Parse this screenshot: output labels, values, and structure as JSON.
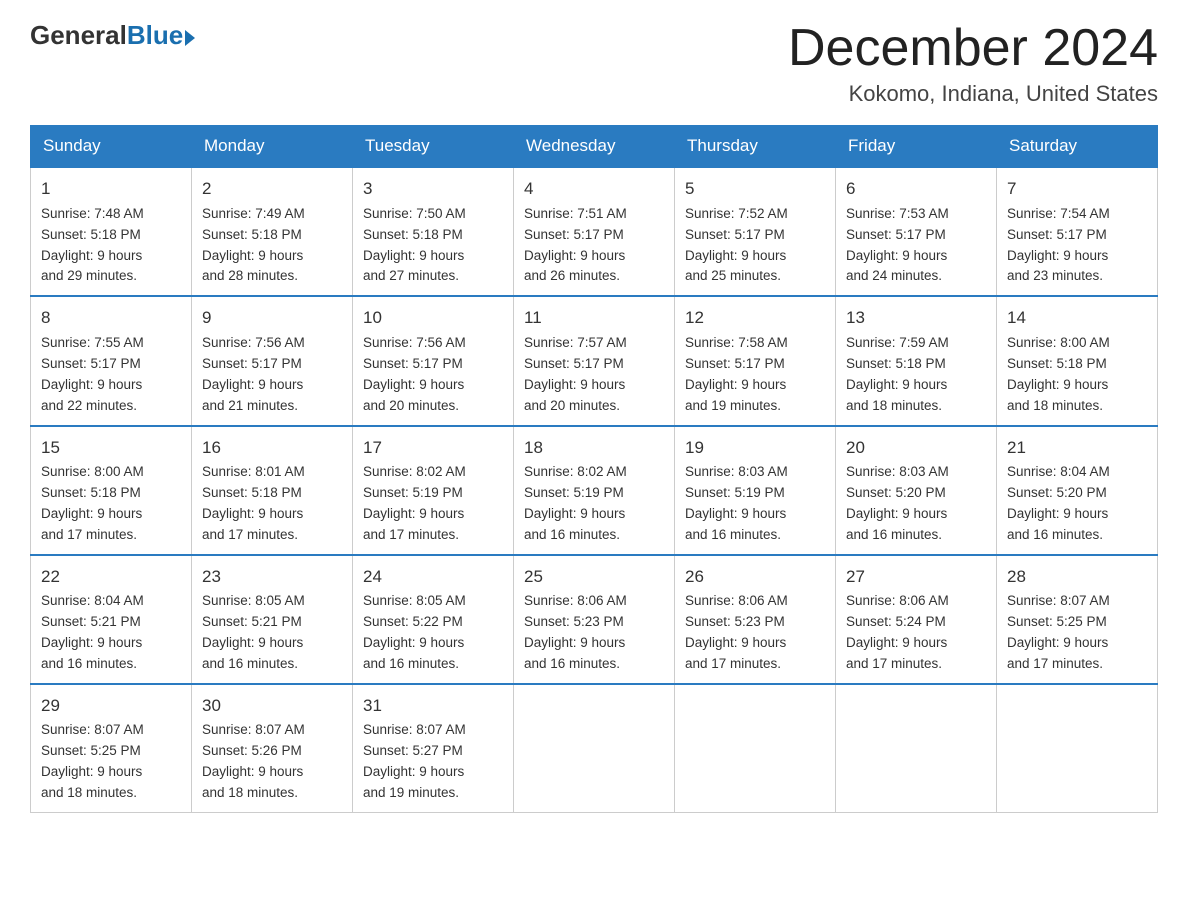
{
  "header": {
    "logo_general": "General",
    "logo_blue": "Blue",
    "month_title": "December 2024",
    "location": "Kokomo, Indiana, United States"
  },
  "weekdays": [
    "Sunday",
    "Monday",
    "Tuesday",
    "Wednesday",
    "Thursday",
    "Friday",
    "Saturday"
  ],
  "weeks": [
    [
      {
        "day": "1",
        "sunrise": "7:48 AM",
        "sunset": "5:18 PM",
        "daylight": "9 hours and 29 minutes."
      },
      {
        "day": "2",
        "sunrise": "7:49 AM",
        "sunset": "5:18 PM",
        "daylight": "9 hours and 28 minutes."
      },
      {
        "day": "3",
        "sunrise": "7:50 AM",
        "sunset": "5:18 PM",
        "daylight": "9 hours and 27 minutes."
      },
      {
        "day": "4",
        "sunrise": "7:51 AM",
        "sunset": "5:17 PM",
        "daylight": "9 hours and 26 minutes."
      },
      {
        "day": "5",
        "sunrise": "7:52 AM",
        "sunset": "5:17 PM",
        "daylight": "9 hours and 25 minutes."
      },
      {
        "day": "6",
        "sunrise": "7:53 AM",
        "sunset": "5:17 PM",
        "daylight": "9 hours and 24 minutes."
      },
      {
        "day": "7",
        "sunrise": "7:54 AM",
        "sunset": "5:17 PM",
        "daylight": "9 hours and 23 minutes."
      }
    ],
    [
      {
        "day": "8",
        "sunrise": "7:55 AM",
        "sunset": "5:17 PM",
        "daylight": "9 hours and 22 minutes."
      },
      {
        "day": "9",
        "sunrise": "7:56 AM",
        "sunset": "5:17 PM",
        "daylight": "9 hours and 21 minutes."
      },
      {
        "day": "10",
        "sunrise": "7:56 AM",
        "sunset": "5:17 PM",
        "daylight": "9 hours and 20 minutes."
      },
      {
        "day": "11",
        "sunrise": "7:57 AM",
        "sunset": "5:17 PM",
        "daylight": "9 hours and 20 minutes."
      },
      {
        "day": "12",
        "sunrise": "7:58 AM",
        "sunset": "5:17 PM",
        "daylight": "9 hours and 19 minutes."
      },
      {
        "day": "13",
        "sunrise": "7:59 AM",
        "sunset": "5:18 PM",
        "daylight": "9 hours and 18 minutes."
      },
      {
        "day": "14",
        "sunrise": "8:00 AM",
        "sunset": "5:18 PM",
        "daylight": "9 hours and 18 minutes."
      }
    ],
    [
      {
        "day": "15",
        "sunrise": "8:00 AM",
        "sunset": "5:18 PM",
        "daylight": "9 hours and 17 minutes."
      },
      {
        "day": "16",
        "sunrise": "8:01 AM",
        "sunset": "5:18 PM",
        "daylight": "9 hours and 17 minutes."
      },
      {
        "day": "17",
        "sunrise": "8:02 AM",
        "sunset": "5:19 PM",
        "daylight": "9 hours and 17 minutes."
      },
      {
        "day": "18",
        "sunrise": "8:02 AM",
        "sunset": "5:19 PM",
        "daylight": "9 hours and 16 minutes."
      },
      {
        "day": "19",
        "sunrise": "8:03 AM",
        "sunset": "5:19 PM",
        "daylight": "9 hours and 16 minutes."
      },
      {
        "day": "20",
        "sunrise": "8:03 AM",
        "sunset": "5:20 PM",
        "daylight": "9 hours and 16 minutes."
      },
      {
        "day": "21",
        "sunrise": "8:04 AM",
        "sunset": "5:20 PM",
        "daylight": "9 hours and 16 minutes."
      }
    ],
    [
      {
        "day": "22",
        "sunrise": "8:04 AM",
        "sunset": "5:21 PM",
        "daylight": "9 hours and 16 minutes."
      },
      {
        "day": "23",
        "sunrise": "8:05 AM",
        "sunset": "5:21 PM",
        "daylight": "9 hours and 16 minutes."
      },
      {
        "day": "24",
        "sunrise": "8:05 AM",
        "sunset": "5:22 PM",
        "daylight": "9 hours and 16 minutes."
      },
      {
        "day": "25",
        "sunrise": "8:06 AM",
        "sunset": "5:23 PM",
        "daylight": "9 hours and 16 minutes."
      },
      {
        "day": "26",
        "sunrise": "8:06 AM",
        "sunset": "5:23 PM",
        "daylight": "9 hours and 17 minutes."
      },
      {
        "day": "27",
        "sunrise": "8:06 AM",
        "sunset": "5:24 PM",
        "daylight": "9 hours and 17 minutes."
      },
      {
        "day": "28",
        "sunrise": "8:07 AM",
        "sunset": "5:25 PM",
        "daylight": "9 hours and 17 minutes."
      }
    ],
    [
      {
        "day": "29",
        "sunrise": "8:07 AM",
        "sunset": "5:25 PM",
        "daylight": "9 hours and 18 minutes."
      },
      {
        "day": "30",
        "sunrise": "8:07 AM",
        "sunset": "5:26 PM",
        "daylight": "9 hours and 18 minutes."
      },
      {
        "day": "31",
        "sunrise": "8:07 AM",
        "sunset": "5:27 PM",
        "daylight": "9 hours and 19 minutes."
      },
      null,
      null,
      null,
      null
    ]
  ],
  "labels": {
    "sunrise": "Sunrise:",
    "sunset": "Sunset:",
    "daylight": "Daylight:"
  }
}
